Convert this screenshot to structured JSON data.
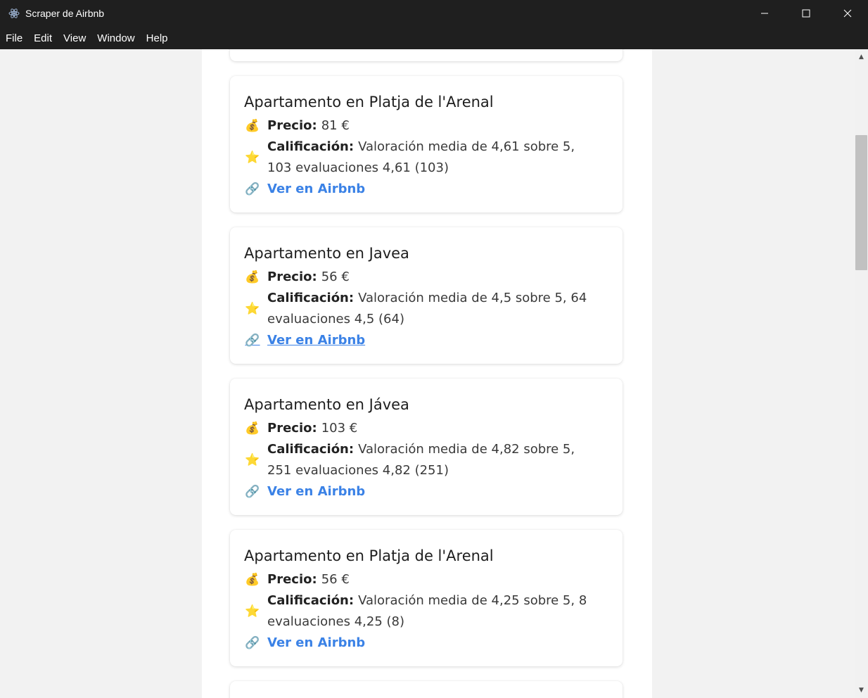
{
  "window": {
    "title": "Scraper de Airbnb",
    "controls": {
      "minimize": "—",
      "maximize": "☐",
      "close": "✕"
    }
  },
  "menu": [
    "File",
    "Edit",
    "View",
    "Window",
    "Help"
  ],
  "listings": [
    {
      "title": "Apartamento en Platja de l'Arenal",
      "price_label": "Precio:",
      "price": "81 €",
      "rating_label": "Calificación:",
      "rating": "Valoración media de 4,61 sobre 5, 103 evaluaciones 4,61 (103)",
      "link": "Ver en Airbnb"
    },
    {
      "title": "Apartamento en Javea",
      "price_label": "Precio:",
      "price": "56 €",
      "rating_label": "Calificación:",
      "rating": "Valoración media de 4,5 sobre 5, 64 evaluaciones 4,5 (64)",
      "link": "Ver en Airbnb"
    },
    {
      "title": "Apartamento en Jávea",
      "price_label": "Precio:",
      "price": "103 €",
      "rating_label": "Calificación:",
      "rating": "Valoración media de 4,82 sobre 5, 251 evaluaciones 4,82 (251)",
      "link": "Ver en Airbnb"
    },
    {
      "title": "Apartamento en Platja de l'Arenal",
      "price_label": "Precio:",
      "price": "56 €",
      "rating_label": "Calificación:",
      "rating": "Valoración media de 4,25 sobre 5, 8 evaluaciones 4,25 (8)",
      "link": "Ver en Airbnb"
    }
  ],
  "icons": {
    "price": "money-bag-icon",
    "rating": "star-icon",
    "link": "link-icon"
  },
  "colors": {
    "accent_link": "#3b82e6",
    "titlebar": "#1f1f1f"
  }
}
